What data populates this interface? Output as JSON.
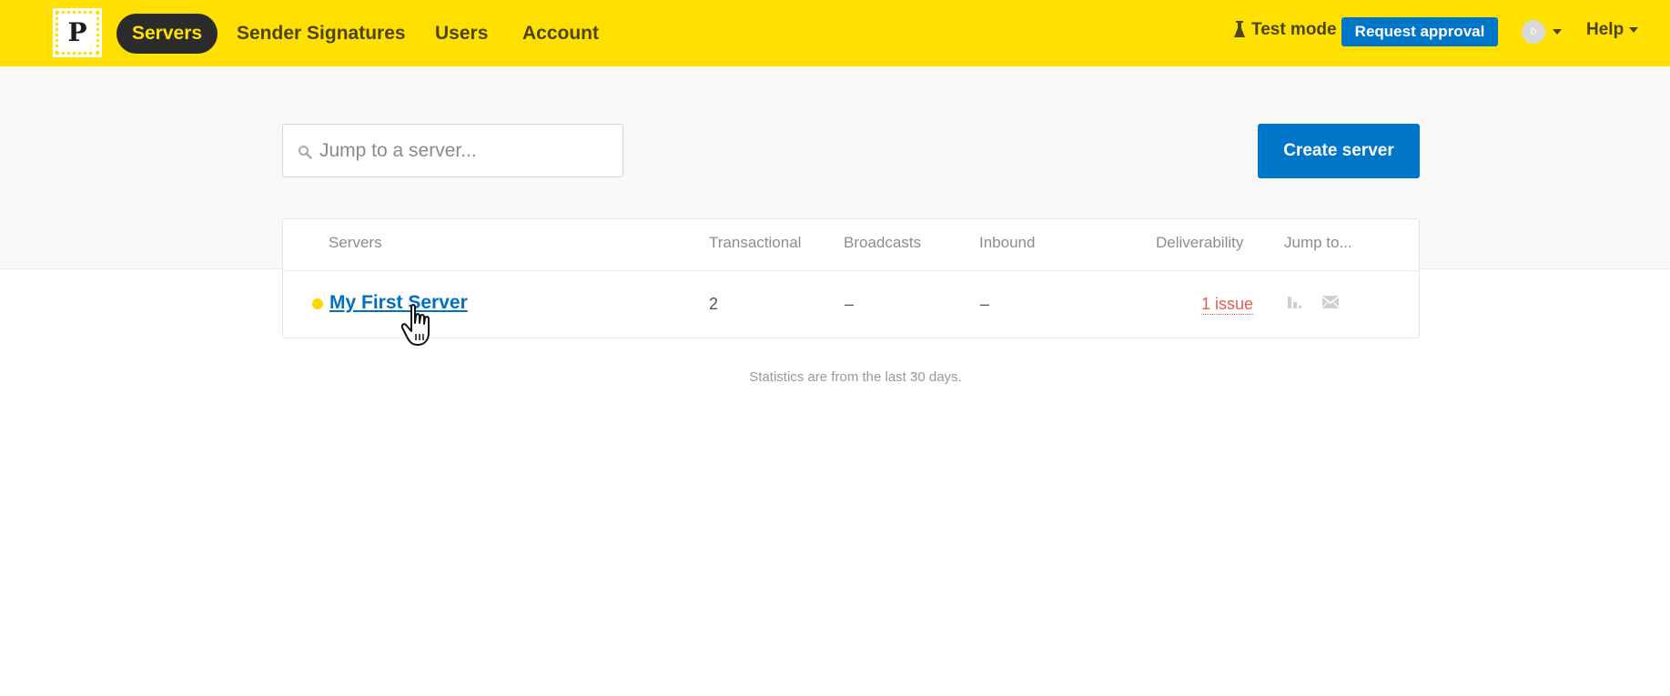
{
  "nav": {
    "logo_letter": "P",
    "items": [
      {
        "label": "Servers",
        "active": true
      },
      {
        "label": "Sender Signatures",
        "active": false
      },
      {
        "label": "Users",
        "active": false
      },
      {
        "label": "Account",
        "active": false
      }
    ],
    "test_mode": "Test mode",
    "request_approval": "Request approval",
    "avatar_initial": "D",
    "help": "Help"
  },
  "search": {
    "placeholder": "Jump to a server..."
  },
  "create_server": "Create server",
  "table": {
    "headers": {
      "servers": "Servers",
      "transactional": "Transactional",
      "broadcasts": "Broadcasts",
      "inbound": "Inbound",
      "deliverability": "Deliverability",
      "jump_to": "Jump to..."
    },
    "rows": [
      {
        "name": "My First Server",
        "transactional": "2",
        "broadcasts": "–",
        "inbound": "–",
        "deliverability": "1 issue"
      }
    ]
  },
  "footnote": "Statistics are from the last 30 days.",
  "colors": {
    "brand_yellow": "#ffe000",
    "primary_blue": "#0076c8",
    "issue_red": "#e85a57"
  }
}
